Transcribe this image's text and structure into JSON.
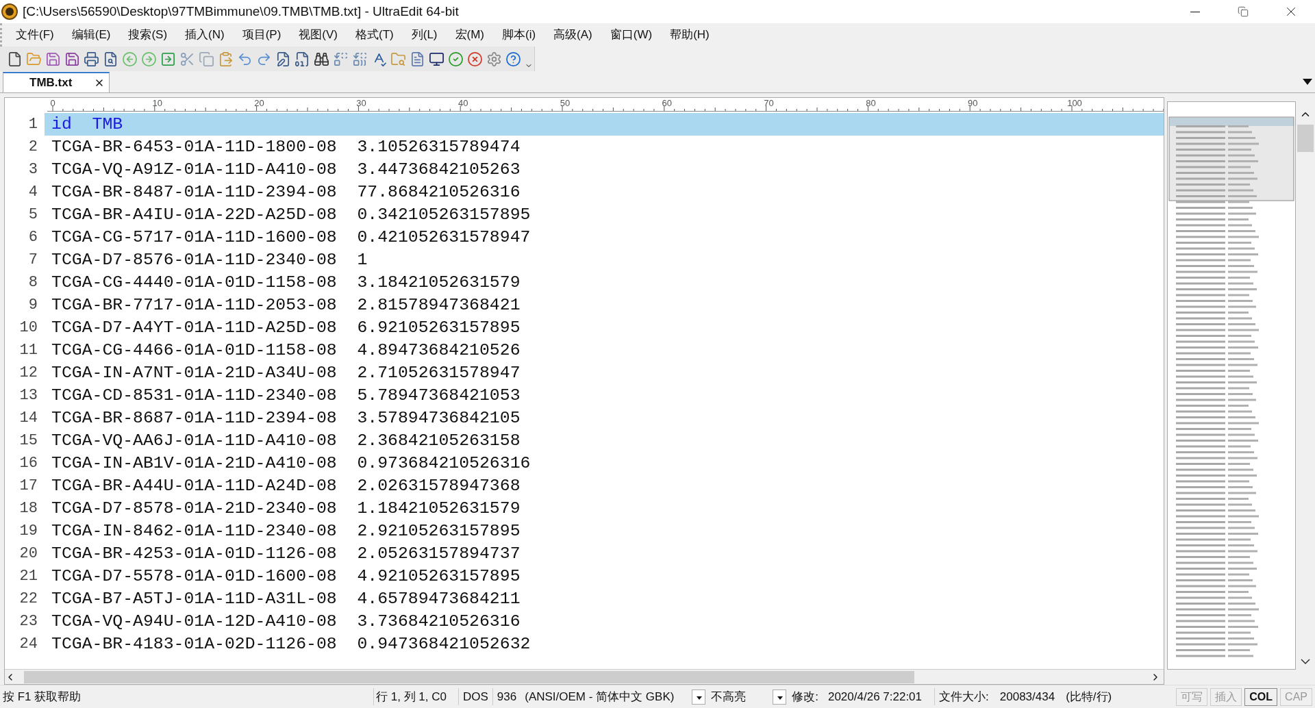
{
  "window": {
    "title": "[C:\\Users\\56590\\Desktop\\97TMBimmune\\09.TMB\\TMB.txt] - UltraEdit 64-bit"
  },
  "menu": [
    "文件(F)",
    "编辑(E)",
    "搜索(S)",
    "插入(N)",
    "项目(P)",
    "视图(V)",
    "格式(T)",
    "列(L)",
    "宏(M)",
    "脚本(i)",
    "高级(A)",
    "窗口(W)",
    "帮助(H)"
  ],
  "tabs": [
    {
      "label": "TMB.txt",
      "selected": true
    }
  ],
  "ruler": [
    "0",
    "10",
    "20",
    "30",
    "40",
    "50",
    "60",
    "70",
    "80",
    "90",
    "100"
  ],
  "lines": [
    {
      "number": "1",
      "text": "id\tTMB",
      "selected": true
    },
    {
      "number": "2",
      "text": "TCGA-BR-6453-01A-11D-1800-08\t3.10526315789474",
      "selected": false
    },
    {
      "number": "3",
      "text": "TCGA-VQ-A91Z-01A-11D-A410-08\t3.44736842105263",
      "selected": false
    },
    {
      "number": "4",
      "text": "TCGA-BR-8487-01A-11D-2394-08\t77.8684210526316",
      "selected": false
    },
    {
      "number": "5",
      "text": "TCGA-BR-A4IU-01A-22D-A25D-08\t0.342105263157895",
      "selected": false
    },
    {
      "number": "6",
      "text": "TCGA-CG-5717-01A-11D-1600-08\t0.421052631578947",
      "selected": false
    },
    {
      "number": "7",
      "text": "TCGA-D7-8576-01A-11D-2340-08\t1",
      "selected": false
    },
    {
      "number": "8",
      "text": "TCGA-CG-4440-01A-01D-1158-08\t3.18421052631579",
      "selected": false
    },
    {
      "number": "9",
      "text": "TCGA-BR-7717-01A-11D-2053-08\t2.81578947368421",
      "selected": false
    },
    {
      "number": "10",
      "text": "TCGA-D7-A4YT-01A-11D-A25D-08\t6.92105263157895",
      "selected": false
    },
    {
      "number": "11",
      "text": "TCGA-CG-4466-01A-01D-1158-08\t4.89473684210526",
      "selected": false
    },
    {
      "number": "12",
      "text": "TCGA-IN-A7NT-01A-21D-A34U-08\t2.71052631578947",
      "selected": false
    },
    {
      "number": "13",
      "text": "TCGA-CD-8531-01A-11D-2340-08\t5.78947368421053",
      "selected": false
    },
    {
      "number": "14",
      "text": "TCGA-BR-8687-01A-11D-2394-08\t3.57894736842105",
      "selected": false
    },
    {
      "number": "15",
      "text": "TCGA-VQ-AA6J-01A-11D-A410-08\t2.36842105263158",
      "selected": false
    },
    {
      "number": "16",
      "text": "TCGA-IN-AB1V-01A-21D-A410-08\t0.973684210526316",
      "selected": false
    },
    {
      "number": "17",
      "text": "TCGA-BR-A44U-01A-11D-A24D-08\t2.02631578947368",
      "selected": false
    },
    {
      "number": "18",
      "text": "TCGA-D7-8578-01A-21D-2340-08\t1.18421052631579",
      "selected": false
    },
    {
      "number": "19",
      "text": "TCGA-IN-8462-01A-11D-2340-08\t2.92105263157895",
      "selected": false
    },
    {
      "number": "20",
      "text": "TCGA-BR-4253-01A-01D-1126-08\t2.05263157894737",
      "selected": false
    },
    {
      "number": "21",
      "text": "TCGA-D7-5578-01A-01D-1600-08\t4.92105263157895",
      "selected": false
    },
    {
      "number": "22",
      "text": "TCGA-B7-A5TJ-01A-11D-A31L-08\t4.65789473684211",
      "selected": false
    },
    {
      "number": "23",
      "text": "TCGA-VQ-A94U-01A-12D-A410-08\t3.73684210526316",
      "selected": false
    },
    {
      "number": "24",
      "text": "TCGA-BR-4183-01A-02D-1126-08\t0.947368421052632",
      "selected": false
    }
  ],
  "status_bar": {
    "help": "按 F1 获取帮助",
    "position": "行 1, 列 1, C0",
    "line_ending": "DOS",
    "codepage": "936",
    "encoding": "(ANSI/OEM - 简体中文 GBK)",
    "highlight": "不高亮",
    "modified_label": "修改:",
    "modified": "2020/4/26 7:22:01",
    "size_label": "文件大小:",
    "size": "20083/434",
    "size_unit": "(比特/行)",
    "indicators": [
      {
        "label": "可写",
        "on": false
      },
      {
        "label": "插入",
        "on": false
      },
      {
        "label": "COL",
        "on": true
      },
      {
        "label": "CAP",
        "on": false
      }
    ]
  }
}
